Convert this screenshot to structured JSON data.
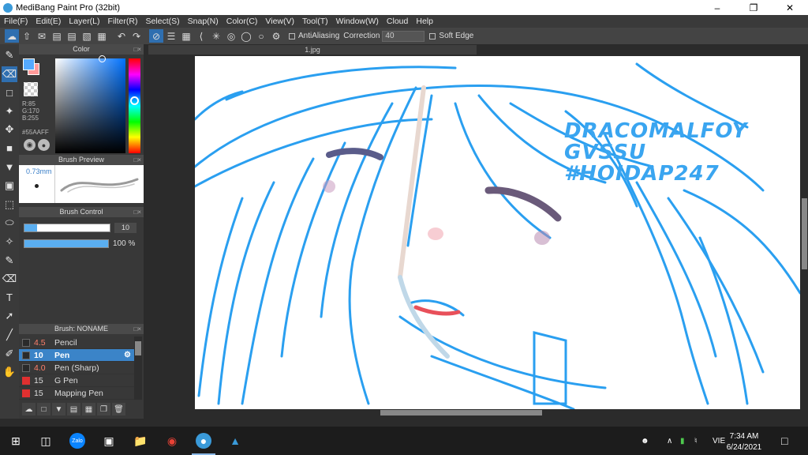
{
  "window": {
    "title": "MediBang Paint Pro (32bit)",
    "min_icon": "minimize-icon",
    "max_icon": "maximize-icon",
    "close_icon": "close-icon"
  },
  "menu": [
    "File(F)",
    "Edit(E)",
    "Layer(L)",
    "Filter(R)",
    "Select(S)",
    "Snap(N)",
    "Color(C)",
    "View(V)",
    "Tool(T)",
    "Window(W)",
    "Cloud",
    "Help"
  ],
  "toolbar": {
    "antialiasing_label": "AntiAliasing",
    "correction_label": "Correction",
    "correction_value": "40",
    "soft_edge_label": "Soft Edge"
  },
  "color_panel": {
    "title": "Color",
    "r": "R:85",
    "g": "G:170",
    "b": "B:255",
    "hex": "#55AAFF",
    "fg_color": "#55aaff",
    "bg_color": "#ff9a9a"
  },
  "brush_preview": {
    "title": "Brush Preview",
    "size": "0.73mm"
  },
  "brush_control": {
    "title": "Brush Control",
    "size_value": "10",
    "size_fraction": 0.15,
    "opacity_value": "100 %",
    "opacity_fraction": 1.0
  },
  "brush_list": {
    "title": "Brush: NONAME",
    "items": [
      {
        "size": "4.5",
        "name": "Pencil",
        "color": "#2a2a2a",
        "size_red": true,
        "selected": false
      },
      {
        "size": "10",
        "name": "Pen",
        "color": "#2a2a2a",
        "size_red": false,
        "selected": true
      },
      {
        "size": "4.0",
        "name": "Pen (Sharp)",
        "color": "#2a2a2a",
        "size_red": true,
        "selected": false
      },
      {
        "size": "15",
        "name": "G Pen",
        "color": "#e03030",
        "size_red": false,
        "selected": false
      },
      {
        "size": "15",
        "name": "Mapping Pen",
        "color": "#e03030",
        "size_red": false,
        "selected": false
      }
    ]
  },
  "canvas": {
    "tab": "1.jpg",
    "watermark_line1": "DRACOMALFOY GVSSU",
    "watermark_line2": "#HOIDAP247"
  },
  "taskbar": {
    "language": "VIE",
    "time": "7:34 AM",
    "date": "6/24/2021"
  }
}
